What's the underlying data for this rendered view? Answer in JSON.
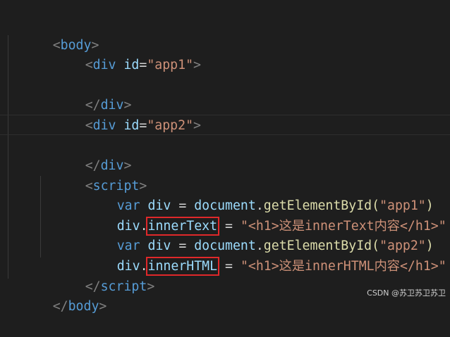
{
  "lines": {
    "l1": {
      "open": "<",
      "tag": "body",
      "close": ">"
    },
    "l2": {
      "open": "<",
      "tag": "div",
      "attr": "id",
      "eq": "=",
      "val": "\"app1\"",
      "close": ">"
    },
    "l4": {
      "open": "</",
      "tag": "div",
      "close": ">"
    },
    "l5": {
      "open": "<",
      "tag": "div",
      "attr": "id",
      "eq": "=",
      "val": "\"app2\"",
      "close": ">"
    },
    "l7": {
      "open": "</",
      "tag": "div",
      "close": ">"
    },
    "l8": {
      "open": "<",
      "tag": "script",
      "close": ">"
    },
    "l9": {
      "kw": "var",
      "name": "div",
      "eq": " = ",
      "obj": "document",
      "dot": ".",
      "fn": "getElementById",
      "lp": "(",
      "arg": "\"app1\"",
      "rp": ")"
    },
    "l10": {
      "obj": "div",
      "dot": ".",
      "prop": "innerText",
      "eq": " = ",
      "str": "\"<h1>这是innerText内容</h1>\""
    },
    "l11": {
      "kw": "var",
      "name": "div",
      "eq": " = ",
      "obj": "document",
      "dot": ".",
      "fn": "getElementById",
      "lp": "(",
      "arg": "\"app2\"",
      "rp": ")"
    },
    "l12": {
      "obj": "div",
      "dot": ".",
      "prop": "innerHTML",
      "eq": " = ",
      "str": "\"<h1>这是innerHTML内容</h1>\""
    },
    "l13": {
      "open": "</",
      "tag": "script",
      "close": ">"
    },
    "l14": {
      "open": "</",
      "tag": "body",
      "close": ">"
    }
  },
  "watermark": "CSDN @苏卫苏卫苏卫",
  "colors": {
    "background": "#1e1e1e",
    "tag": "#569cd6",
    "attribute": "#9cdcfe",
    "string": "#ce9178",
    "function": "#dcdcaa",
    "highlight_box": "#e0282a"
  }
}
